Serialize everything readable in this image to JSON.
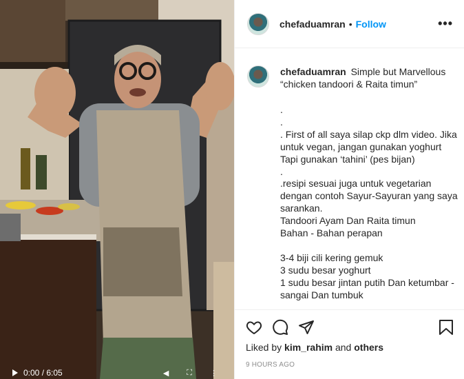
{
  "post": {
    "author": "chefaduamran",
    "separator": "•",
    "follow_label": "Follow",
    "more_label": "•••"
  },
  "caption": {
    "username": "chefaduamran",
    "title": "Simple but Marvellous “chicken tandoori & Raita timun”",
    "lines": [
      ".",
      ".",
      ". First of all saya silap ckp dlm video. Jika untuk vegan, jangan gunakan yoghurt Tapi gunakan ‘tahini’ (pes bijan)",
      ".",
      ".resipi sesuai juga untuk vegetarian dengan contoh Sayur-Sayuran yang saya sarankan.",
      "Tandoori Ayam Dan Raita timun",
      "Bahan - Bahan perapan",
      "",
      "3-4 biji cili kering gemuk",
      "3 sudu besar yoghurt",
      "1 sudu besar jintan putih Dan ketumbar - sangai Dan tumbuk"
    ]
  },
  "likes": {
    "prefix": "Liked by",
    "user": "kim_rahim",
    "conjunction": "and",
    "others": "others"
  },
  "timestamp": "9 HOURS AGO",
  "video": {
    "time": "0:00 / 6:05"
  },
  "icons": [
    "heart-icon",
    "comment-icon",
    "share-icon",
    "bookmark-icon",
    "more-options-icon",
    "play-icon"
  ],
  "colors": {
    "accent": "#0095f6",
    "text": "#262626",
    "muted": "#8e8e8e",
    "border": "#efefef"
  }
}
